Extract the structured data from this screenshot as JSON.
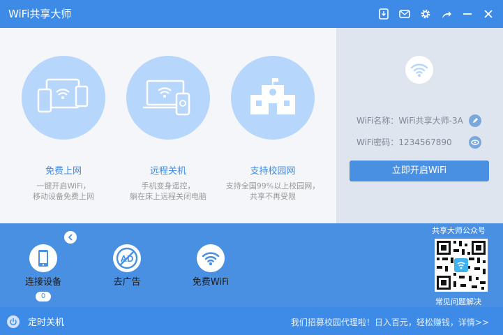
{
  "app": {
    "title": "WiFi共享大师"
  },
  "titlebar": {
    "icons": [
      "download-icon",
      "mail-icon",
      "gear-icon",
      "share-icon",
      "minimize-icon",
      "close-icon"
    ]
  },
  "features": [
    {
      "title": "免费上网",
      "desc1": "一键开启WiFi，",
      "desc2": "移动设备免费上网",
      "icon": "devices-wifi-icon"
    },
    {
      "title": "远程关机",
      "desc1": "手机变身遥控，",
      "desc2": "躺在床上远程关闭电脑",
      "icon": "remote-shutdown-icon"
    },
    {
      "title": "支持校园网",
      "desc1": "支持全国99%以上校园网，",
      "desc2": "共享不再受限",
      "icon": "school-icon"
    }
  ],
  "wifi": {
    "name_label": "WiFi名称：",
    "name_value": "WiFi共享大师-3A",
    "password_label": "WiFi密码：",
    "password_value": "1234567890",
    "start_button": "立即开启WiFi"
  },
  "tools": [
    {
      "label": "连接设备",
      "icon": "phone-icon",
      "badge": "0"
    },
    {
      "label": "去广告",
      "icon": "no-ad-icon"
    },
    {
      "label": "免费WiFi",
      "icon": "wifi-icon"
    }
  ],
  "qr": {
    "title": "共享大师公众号",
    "caption": "常见问题解决"
  },
  "footer": {
    "timer_label": "定时关机",
    "promo": "我们招募校园代理啦！日入百元，轻松赚钱，详情>>"
  },
  "colors": {
    "accent": "#4a90e2",
    "title_bar": "#3d8be6",
    "circle": "#b7d6fb"
  }
}
